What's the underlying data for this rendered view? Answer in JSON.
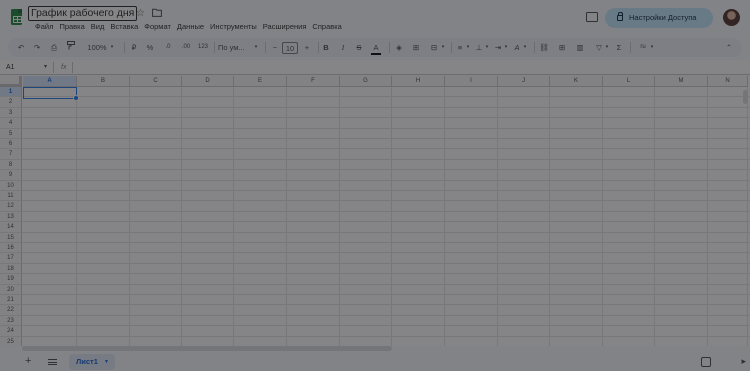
{
  "document": {
    "title": "График рабочего дня"
  },
  "menu": [
    "Файл",
    "Правка",
    "Вид",
    "Вставка",
    "Формат",
    "Данные",
    "Инструменты",
    "Расширения",
    "Справка"
  ],
  "share": {
    "label": "Настройки Доступа"
  },
  "toolbar": {
    "undo": "↶",
    "redo": "↷",
    "print": "⎙",
    "paint_format": "🖌",
    "zoom": "100%",
    "currency": "₽",
    "percent": "%",
    "decimal_decrease": ".0",
    "decimal_increase": ".00",
    "number_format": "123",
    "font": "По ум...",
    "font_size_minus": "−",
    "font_size": "10",
    "font_size_plus": "+",
    "bold": "B",
    "italic": "I",
    "strike": "S",
    "text_color": "A",
    "fill": "◈",
    "borders": "⊞",
    "merge": "⊟",
    "align": "≡",
    "valign": "⊥",
    "wrap": "⇥",
    "rotate": "A",
    "link": "⛓",
    "comment": "⊞",
    "chart": "▥",
    "filter": "▽",
    "functions": "Σ",
    "input_tools": "ru",
    "collapse": "⌃"
  },
  "formula_bar": {
    "cell_ref": "A1",
    "fx": "fx",
    "value": ""
  },
  "columns": [
    "A",
    "B",
    "C",
    "D",
    "E",
    "F",
    "G",
    "H",
    "I",
    "J",
    "K",
    "L",
    "M",
    "N"
  ],
  "rows": [
    "1",
    "2",
    "3",
    "4",
    "5",
    "6",
    "7",
    "8",
    "9",
    "10",
    "11",
    "12",
    "13",
    "14",
    "15",
    "16",
    "17",
    "18",
    "19",
    "20",
    "21",
    "22",
    "23",
    "24",
    "25"
  ],
  "sheets": [
    {
      "name": "Лист1"
    }
  ],
  "icons": {
    "star": "☆",
    "move": "🗀",
    "add_sheet": "+",
    "expand": "▸"
  },
  "colors": {
    "accent": "#0b57d0",
    "sheets_green": "#188038",
    "share_bg": "#c2e7ff",
    "selection": "#1a73e8"
  }
}
